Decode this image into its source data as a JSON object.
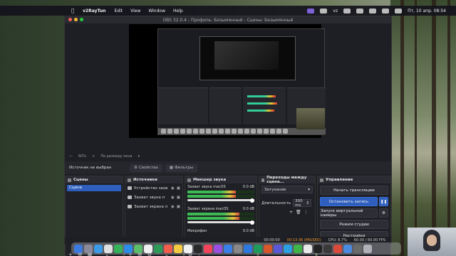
{
  "menubar": {
    "app_name": "v2RayTun",
    "items": [
      "Edit",
      "View",
      "Window",
      "Help"
    ],
    "datetime": "Пт, 10 апр.  08:54",
    "lang": "vz"
  },
  "window": {
    "title": "OBS 32.0.4 - Профиль: Безымянный - Сцены: Безымянный"
  },
  "zoombar": {
    "zoom": "60%",
    "fit": "По размеру окна"
  },
  "properties_bar": {
    "no_source": "Источник не выбран",
    "properties_label": "Свойства",
    "filters_label": "Фильтры"
  },
  "scenes": {
    "title": "Сцены",
    "items": [
      "Сцена"
    ]
  },
  "sources": {
    "title": "Источники",
    "items": [
      "Устройство захв",
      "Захват звука п",
      "Захват экрана п"
    ]
  },
  "mixer": {
    "title": "Микшер звука",
    "channels": [
      {
        "name": "Захват звука macOS",
        "db": "0.0 dB",
        "level": 0.72
      },
      {
        "name": "Захват экрана macOS",
        "db": "0.0 dB",
        "level": 0.78
      },
      {
        "name": "Микрофон",
        "db": "0.0 dB",
        "level": 0.0
      }
    ]
  },
  "transitions": {
    "title": "Переходы между сцена...",
    "type": "Затухание",
    "duration_label": "Длительность",
    "duration": "300 ms"
  },
  "controls": {
    "title": "Управление",
    "start_stream": "Начать трансляцию",
    "stop_recording": "Остановить запись",
    "virtual_cam": "Запуск виртуальной камеры",
    "studio_mode": "Режим студии",
    "settings": "Настройки"
  },
  "status": {
    "stream_time": "00:00:00",
    "rec_time": "00:13:36 (PAUSED)",
    "cpu": "CPU: 8.7%",
    "fps": "60.00 / 60.00 FPS"
  },
  "colors": {
    "accent": "#2f5fbe",
    "rec": "#e8962e"
  }
}
